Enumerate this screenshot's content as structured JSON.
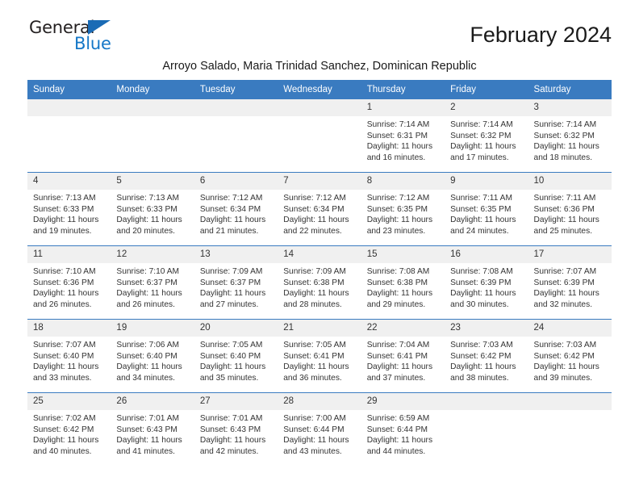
{
  "brand": {
    "name_top": "General",
    "name_bottom": "Blue",
    "triangle_color": "#1a6bb5",
    "blue_color": "#1577c7",
    "dark_color": "#231f20"
  },
  "header": {
    "title": "February 2024",
    "subtitle": "Arroyo Salado, Maria Trinidad Sanchez, Dominican Republic",
    "accent_color": "#3a7bc0",
    "daynum_band_color": "#f0f0f0"
  },
  "weekday_headers": [
    "Sunday",
    "Monday",
    "Tuesday",
    "Wednesday",
    "Thursday",
    "Friday",
    "Saturday"
  ],
  "labels": {
    "sunrise_prefix": "Sunrise:",
    "sunset_prefix": "Sunset:",
    "daylight_prefix": "Daylight:"
  },
  "weeks": [
    [
      {
        "day": "",
        "blank": true,
        "sunrise": "",
        "sunset": "",
        "daylight_line1": "",
        "daylight_line2": ""
      },
      {
        "day": "",
        "blank": true,
        "sunrise": "",
        "sunset": "",
        "daylight_line1": "",
        "daylight_line2": ""
      },
      {
        "day": "",
        "blank": true,
        "sunrise": "",
        "sunset": "",
        "daylight_line1": "",
        "daylight_line2": ""
      },
      {
        "day": "",
        "blank": true,
        "sunrise": "",
        "sunset": "",
        "daylight_line1": "",
        "daylight_line2": ""
      },
      {
        "day": "1",
        "blank": false,
        "sunrise": "Sunrise: 7:14 AM",
        "sunset": "Sunset: 6:31 PM",
        "daylight_line1": "Daylight: 11 hours",
        "daylight_line2": "and 16 minutes."
      },
      {
        "day": "2",
        "blank": false,
        "sunrise": "Sunrise: 7:14 AM",
        "sunset": "Sunset: 6:32 PM",
        "daylight_line1": "Daylight: 11 hours",
        "daylight_line2": "and 17 minutes."
      },
      {
        "day": "3",
        "blank": false,
        "sunrise": "Sunrise: 7:14 AM",
        "sunset": "Sunset: 6:32 PM",
        "daylight_line1": "Daylight: 11 hours",
        "daylight_line2": "and 18 minutes."
      }
    ],
    [
      {
        "day": "4",
        "blank": false,
        "sunrise": "Sunrise: 7:13 AM",
        "sunset": "Sunset: 6:33 PM",
        "daylight_line1": "Daylight: 11 hours",
        "daylight_line2": "and 19 minutes."
      },
      {
        "day": "5",
        "blank": false,
        "sunrise": "Sunrise: 7:13 AM",
        "sunset": "Sunset: 6:33 PM",
        "daylight_line1": "Daylight: 11 hours",
        "daylight_line2": "and 20 minutes."
      },
      {
        "day": "6",
        "blank": false,
        "sunrise": "Sunrise: 7:12 AM",
        "sunset": "Sunset: 6:34 PM",
        "daylight_line1": "Daylight: 11 hours",
        "daylight_line2": "and 21 minutes."
      },
      {
        "day": "7",
        "blank": false,
        "sunrise": "Sunrise: 7:12 AM",
        "sunset": "Sunset: 6:34 PM",
        "daylight_line1": "Daylight: 11 hours",
        "daylight_line2": "and 22 minutes."
      },
      {
        "day": "8",
        "blank": false,
        "sunrise": "Sunrise: 7:12 AM",
        "sunset": "Sunset: 6:35 PM",
        "daylight_line1": "Daylight: 11 hours",
        "daylight_line2": "and 23 minutes."
      },
      {
        "day": "9",
        "blank": false,
        "sunrise": "Sunrise: 7:11 AM",
        "sunset": "Sunset: 6:35 PM",
        "daylight_line1": "Daylight: 11 hours",
        "daylight_line2": "and 24 minutes."
      },
      {
        "day": "10",
        "blank": false,
        "sunrise": "Sunrise: 7:11 AM",
        "sunset": "Sunset: 6:36 PM",
        "daylight_line1": "Daylight: 11 hours",
        "daylight_line2": "and 25 minutes."
      }
    ],
    [
      {
        "day": "11",
        "blank": false,
        "sunrise": "Sunrise: 7:10 AM",
        "sunset": "Sunset: 6:36 PM",
        "daylight_line1": "Daylight: 11 hours",
        "daylight_line2": "and 26 minutes."
      },
      {
        "day": "12",
        "blank": false,
        "sunrise": "Sunrise: 7:10 AM",
        "sunset": "Sunset: 6:37 PM",
        "daylight_line1": "Daylight: 11 hours",
        "daylight_line2": "and 26 minutes."
      },
      {
        "day": "13",
        "blank": false,
        "sunrise": "Sunrise: 7:09 AM",
        "sunset": "Sunset: 6:37 PM",
        "daylight_line1": "Daylight: 11 hours",
        "daylight_line2": "and 27 minutes."
      },
      {
        "day": "14",
        "blank": false,
        "sunrise": "Sunrise: 7:09 AM",
        "sunset": "Sunset: 6:38 PM",
        "daylight_line1": "Daylight: 11 hours",
        "daylight_line2": "and 28 minutes."
      },
      {
        "day": "15",
        "blank": false,
        "sunrise": "Sunrise: 7:08 AM",
        "sunset": "Sunset: 6:38 PM",
        "daylight_line1": "Daylight: 11 hours",
        "daylight_line2": "and 29 minutes."
      },
      {
        "day": "16",
        "blank": false,
        "sunrise": "Sunrise: 7:08 AM",
        "sunset": "Sunset: 6:39 PM",
        "daylight_line1": "Daylight: 11 hours",
        "daylight_line2": "and 30 minutes."
      },
      {
        "day": "17",
        "blank": false,
        "sunrise": "Sunrise: 7:07 AM",
        "sunset": "Sunset: 6:39 PM",
        "daylight_line1": "Daylight: 11 hours",
        "daylight_line2": "and 32 minutes."
      }
    ],
    [
      {
        "day": "18",
        "blank": false,
        "sunrise": "Sunrise: 7:07 AM",
        "sunset": "Sunset: 6:40 PM",
        "daylight_line1": "Daylight: 11 hours",
        "daylight_line2": "and 33 minutes."
      },
      {
        "day": "19",
        "blank": false,
        "sunrise": "Sunrise: 7:06 AM",
        "sunset": "Sunset: 6:40 PM",
        "daylight_line1": "Daylight: 11 hours",
        "daylight_line2": "and 34 minutes."
      },
      {
        "day": "20",
        "blank": false,
        "sunrise": "Sunrise: 7:05 AM",
        "sunset": "Sunset: 6:40 PM",
        "daylight_line1": "Daylight: 11 hours",
        "daylight_line2": "and 35 minutes."
      },
      {
        "day": "21",
        "blank": false,
        "sunrise": "Sunrise: 7:05 AM",
        "sunset": "Sunset: 6:41 PM",
        "daylight_line1": "Daylight: 11 hours",
        "daylight_line2": "and 36 minutes."
      },
      {
        "day": "22",
        "blank": false,
        "sunrise": "Sunrise: 7:04 AM",
        "sunset": "Sunset: 6:41 PM",
        "daylight_line1": "Daylight: 11 hours",
        "daylight_line2": "and 37 minutes."
      },
      {
        "day": "23",
        "blank": false,
        "sunrise": "Sunrise: 7:03 AM",
        "sunset": "Sunset: 6:42 PM",
        "daylight_line1": "Daylight: 11 hours",
        "daylight_line2": "and 38 minutes."
      },
      {
        "day": "24",
        "blank": false,
        "sunrise": "Sunrise: 7:03 AM",
        "sunset": "Sunset: 6:42 PM",
        "daylight_line1": "Daylight: 11 hours",
        "daylight_line2": "and 39 minutes."
      }
    ],
    [
      {
        "day": "25",
        "blank": false,
        "sunrise": "Sunrise: 7:02 AM",
        "sunset": "Sunset: 6:42 PM",
        "daylight_line1": "Daylight: 11 hours",
        "daylight_line2": "and 40 minutes."
      },
      {
        "day": "26",
        "blank": false,
        "sunrise": "Sunrise: 7:01 AM",
        "sunset": "Sunset: 6:43 PM",
        "daylight_line1": "Daylight: 11 hours",
        "daylight_line2": "and 41 minutes."
      },
      {
        "day": "27",
        "blank": false,
        "sunrise": "Sunrise: 7:01 AM",
        "sunset": "Sunset: 6:43 PM",
        "daylight_line1": "Daylight: 11 hours",
        "daylight_line2": "and 42 minutes."
      },
      {
        "day": "28",
        "blank": false,
        "sunrise": "Sunrise: 7:00 AM",
        "sunset": "Sunset: 6:44 PM",
        "daylight_line1": "Daylight: 11 hours",
        "daylight_line2": "and 43 minutes."
      },
      {
        "day": "29",
        "blank": false,
        "sunrise": "Sunrise: 6:59 AM",
        "sunset": "Sunset: 6:44 PM",
        "daylight_line1": "Daylight: 11 hours",
        "daylight_line2": "and 44 minutes."
      },
      {
        "day": "",
        "blank": true,
        "sunrise": "",
        "sunset": "",
        "daylight_line1": "",
        "daylight_line2": ""
      },
      {
        "day": "",
        "blank": true,
        "sunrise": "",
        "sunset": "",
        "daylight_line1": "",
        "daylight_line2": ""
      }
    ]
  ]
}
